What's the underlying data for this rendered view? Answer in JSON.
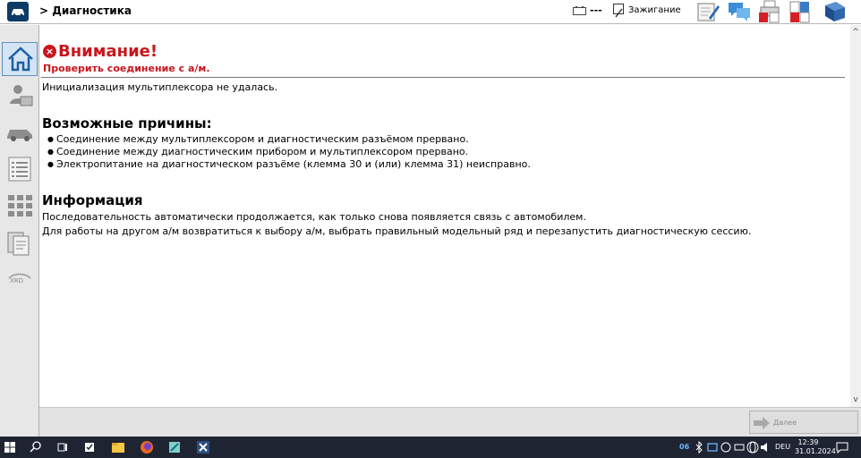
{
  "header": {
    "breadcrumb": "> Диагностика",
    "battery_status": "---",
    "ignition_label": "Зажигание"
  },
  "message": {
    "title": "Внимание!",
    "subtitle": "Проверить соединение с а/м.",
    "intro": "Инициализация мультиплексора не удалась.",
    "causes_title": "Возможные причины:",
    "causes": [
      "Соединение между мультиплексором и диагностическим разъёмом прервано.",
      "Соединение между диагностическим прибором и мультиплексором прервано.",
      "Электропитание на диагностическом разъёме (клемма 30 и (или) клемма 31) неисправно."
    ],
    "info_title": "Информация",
    "info_lines": [
      "Последовательность автоматически продолжается, как только снова появляется связь с автомобилем.",
      "Для работы на другом а/м возвратиться к выбору а/м, выбрать правильный модельный ряд и перезапустить диагностическую сессию."
    ]
  },
  "sidebar": {
    "xrd_label": "XRD"
  },
  "footer": {
    "next_label": "Далее"
  },
  "taskbar": {
    "lang": "DEU",
    "time": "12:39",
    "date": "31.01.2024",
    "badge": "06"
  },
  "colors": {
    "warning": "#c8161d",
    "accent": "#0e3a66"
  }
}
